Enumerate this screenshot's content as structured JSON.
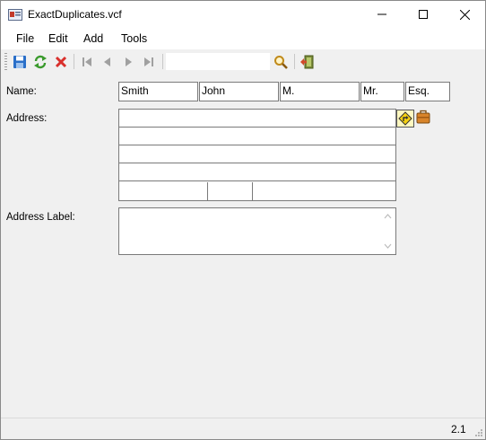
{
  "window": {
    "title": "ExactDuplicates.vcf"
  },
  "menu": {
    "items": [
      "File",
      "Edit",
      "Add",
      "Tools"
    ]
  },
  "toolbar": {
    "search_value": ""
  },
  "form": {
    "name_label": "Name:",
    "name": {
      "last": "Smith",
      "first": "John",
      "middle": "M.",
      "prefix": "Mr.",
      "suffix": "Esq."
    },
    "address_label": "Address:",
    "address": {
      "line1": "",
      "line2": "",
      "line3": "",
      "line4": "",
      "city": "",
      "state": "",
      "zip": ""
    },
    "address_label_label": "Address Label:",
    "address_label_value": ""
  },
  "status": {
    "version": "2.1"
  },
  "colors": {
    "accent_blue": "#2a6fc9",
    "delete_red": "#d9302c",
    "refresh_green": "#3a9a2c",
    "disabled_gray": "#a0a0a0"
  }
}
